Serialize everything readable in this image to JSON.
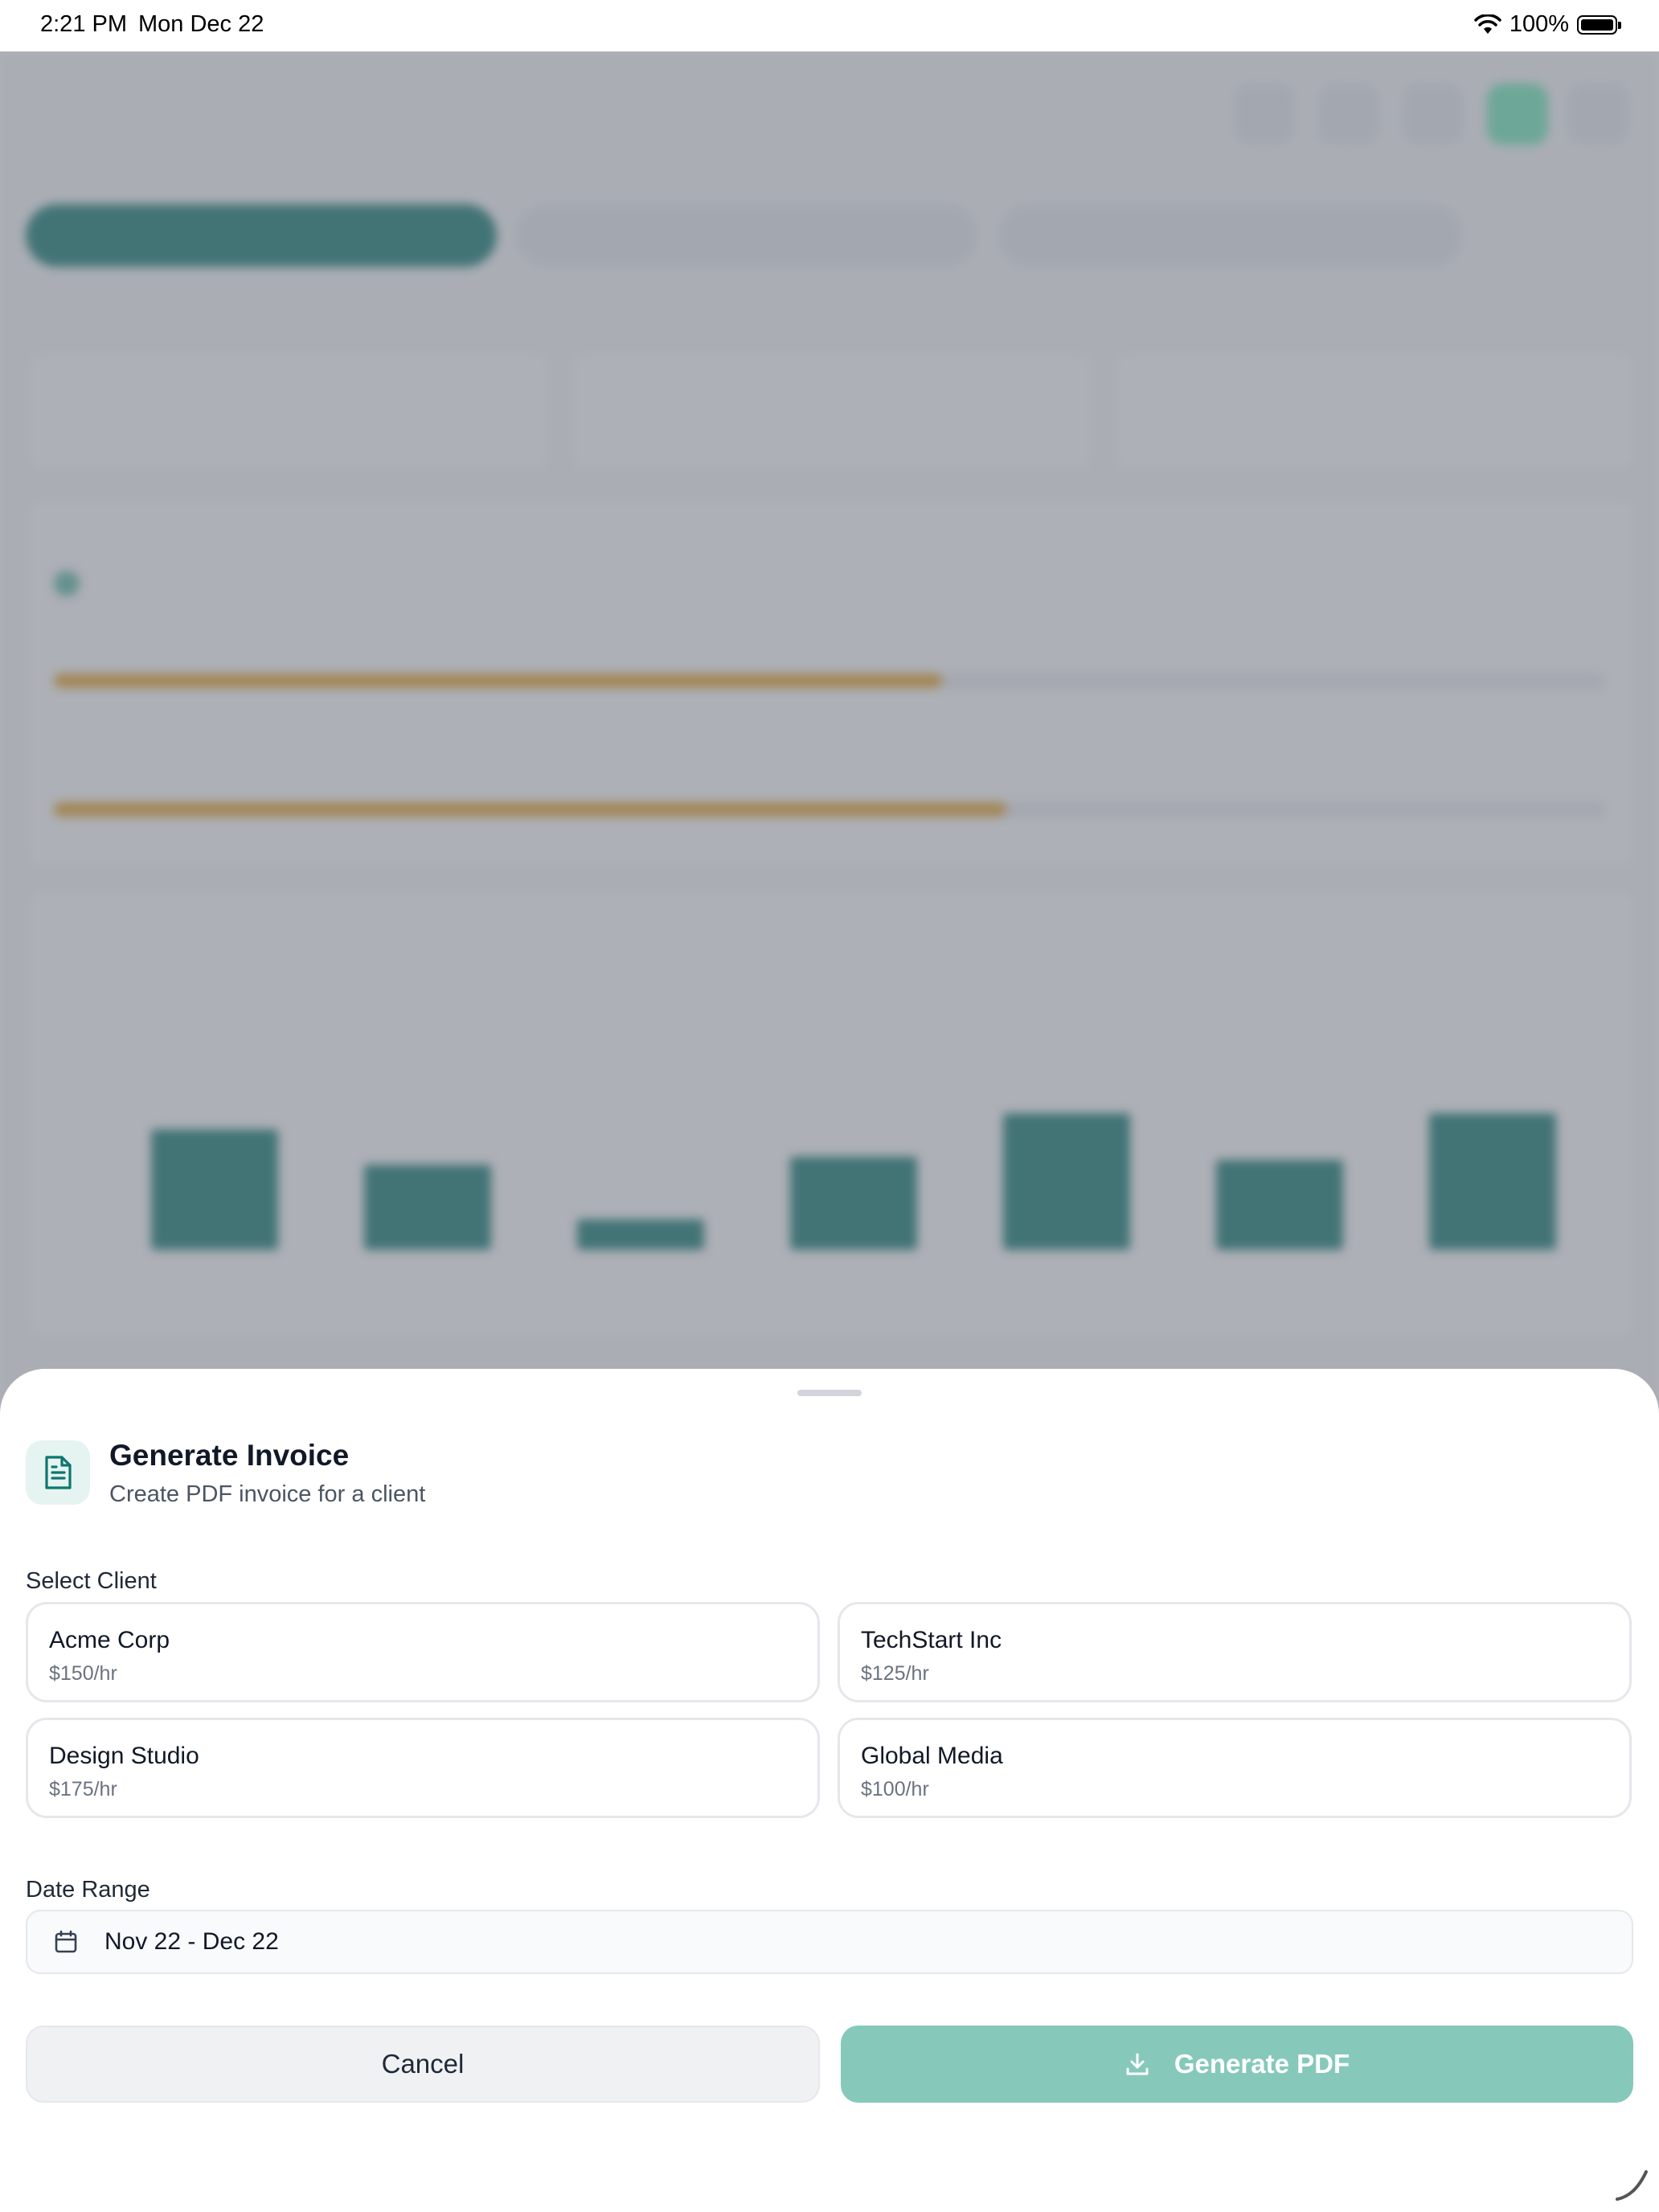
{
  "status_bar": {
    "time": "2:21 PM",
    "date": "Mon Dec 22",
    "battery": "100%"
  },
  "sheet": {
    "title": "Generate Invoice",
    "subtitle": "Create PDF invoice for a client",
    "select_client_label": "Select Client",
    "clients": [
      {
        "name": "Acme Corp",
        "rate": "$150/hr"
      },
      {
        "name": "TechStart Inc",
        "rate": "$125/hr"
      },
      {
        "name": "Design Studio",
        "rate": "$175/hr"
      },
      {
        "name": "Global Media",
        "rate": "$100/hr"
      }
    ],
    "date_range_label": "Date Range",
    "date_range_value": "Nov 22 - Dec 22",
    "cancel_label": "Cancel",
    "generate_label": "Generate PDF"
  },
  "colors": {
    "accent": "#0f766e",
    "generate_button_disabled": "#86c9bb",
    "goal_bar": "#e3a02b"
  },
  "icons": {
    "sheet_icon": "document-icon",
    "date_icon": "calendar-icon",
    "generate_icon": "download-icon"
  }
}
